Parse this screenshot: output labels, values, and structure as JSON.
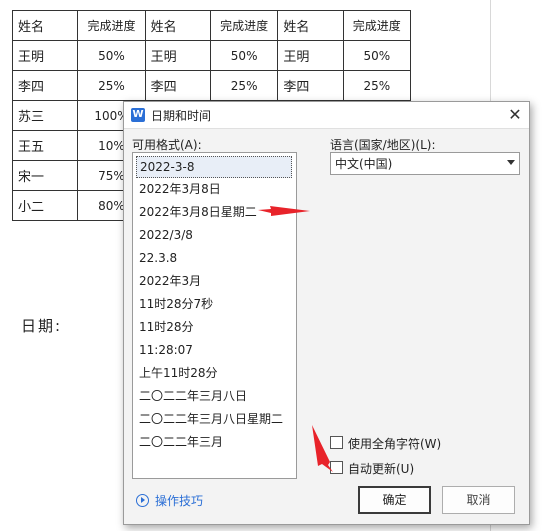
{
  "table": {
    "header": [
      "姓名",
      "完成进度",
      "姓名",
      "完成进度",
      "姓名",
      "完成进度"
    ],
    "rows": [
      [
        "王明",
        "50%",
        "王明",
        "50%",
        "王明",
        "50%"
      ],
      [
        "李四",
        "25%",
        "李四",
        "25%",
        "李四",
        "25%"
      ],
      [
        "苏三",
        "100%",
        "",
        "",
        "",
        ""
      ],
      [
        "王五",
        "10%",
        "",
        "",
        "",
        ""
      ],
      [
        "宋一",
        "75%",
        "",
        "",
        "",
        ""
      ],
      [
        "小二",
        "80%",
        "",
        "",
        "",
        ""
      ]
    ]
  },
  "document": {
    "date_label": "日期:"
  },
  "dialog": {
    "title": "日期和时间",
    "close_glyph": "✕",
    "formats_label": "可用格式(A):",
    "formats": [
      "2022-3-8",
      "2022年3月8日",
      "2022年3月8日星期二",
      "2022/3/8",
      "22.3.8",
      "2022年3月",
      "11时28分7秒",
      "11时28分",
      "11:28:07",
      "上午11时28分",
      "二〇二二年三月八日",
      "二〇二二年三月八日星期二",
      "二〇二二年三月"
    ],
    "selected_index": 0,
    "language_label": "语言(国家/地区)(L):",
    "language_value": "中文(中国)",
    "fullwidth_label": "使用全角字符(W)",
    "auto_update_label": "自动更新(U)",
    "help_label": "操作技巧",
    "ok_label": "确定",
    "cancel_label": "取消"
  },
  "colors": {
    "accent": "#2b6fd6",
    "annotation": "#e8232a"
  }
}
